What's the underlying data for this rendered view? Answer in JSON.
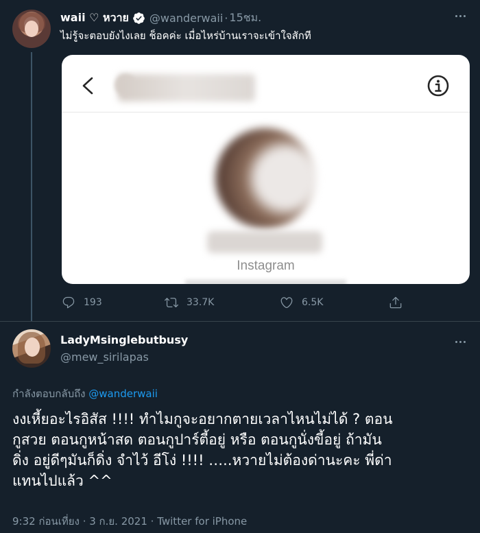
{
  "parent_tweet": {
    "display_name": "waii ♡ หวาย",
    "handle": "@wanderwaii",
    "separator": "·",
    "time": "15ชม.",
    "text": "ไม่รู้จะตอบยังไงเลย ช็อคค่ะ เมื่อไหร่บ้านเราจะเข้าใจสักที",
    "card": {
      "caption": "Instagram"
    },
    "actions": {
      "reply_count": "193",
      "retweet_count": "33.7K",
      "like_count": "6.5K"
    }
  },
  "reply_tweet": {
    "display_name": "LadyMsinglebutbusy",
    "handle": "@mew_sirilapas",
    "replying_prefix": "กำลังตอบกลับถึง",
    "replying_to": "@wanderwaii",
    "body_lines": [
      "งงเหี้ยอะไรอิสัส !!!! ทำไมกูจะอยากตายเวลาไหนไม่ได้ ? ตอน",
      "กูสวย ตอนกูหน้าสด  ตอนกูปาร์ตี้อยู่ หรือ ตอนกูนั่งขี้อยู่ ถ้ามัน",
      "ดิ่ง อยู่ดีๆมันก็ดิ่ง จำไว้ อีโง่ !!!! …..หวายไม่ต้องด่านะคะ พี่ด่า",
      "แทนไปแล้ว ^^"
    ],
    "meta": "9:32 ก่อนเที่ยง · 3 ก.ย. 2021 · Twitter for iPhone"
  },
  "colors": {
    "background": "#15202b",
    "secondary_text": "#8899a6",
    "link": "#1d9bf0",
    "verified": "#1d9bf0"
  }
}
